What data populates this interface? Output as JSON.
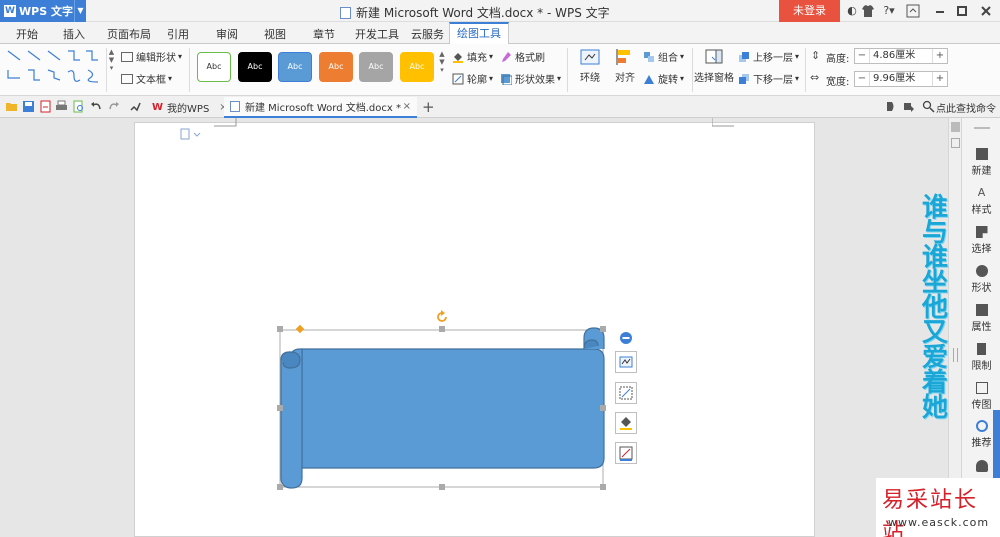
{
  "titlebar": {
    "app_name": "WPS 文字",
    "doc_title": "新建 Microsoft Word 文档.docx * - WPS 文字",
    "login_label": "未登录",
    "help_label": "?"
  },
  "menu": {
    "tabs": [
      "开始",
      "插入",
      "页面布局",
      "引用",
      "审阅",
      "视图",
      "章节",
      "开发工具",
      "云服务",
      "绘图工具"
    ],
    "active_index": 9
  },
  "ribbon": {
    "edit_shape": "编辑形状",
    "textbox": "文本框",
    "style_swatches": [
      {
        "label": "Abc",
        "bg": "#ffffff",
        "fg": "#333333",
        "border": "#6aba4c"
      },
      {
        "label": "Abc",
        "bg": "#000000",
        "fg": "#ffffff",
        "border": "#000000"
      },
      {
        "label": "Abc",
        "bg": "#5b9bd5",
        "fg": "#ffffff",
        "border": "#3d7fd6"
      },
      {
        "label": "Abc",
        "bg": "#ed7d31",
        "fg": "#ffffff",
        "border": "#ed7d31"
      },
      {
        "label": "Abc",
        "bg": "#a5a5a5",
        "fg": "#ffffff",
        "border": "#a5a5a5"
      },
      {
        "label": "Abc",
        "bg": "#ffc000",
        "fg": "#ffffff",
        "border": "#ffc000"
      }
    ],
    "fill": "填充",
    "format_brush": "格式刷",
    "outline": "轮廓",
    "shape_effect": "形状效果",
    "wrap": "环绕",
    "align": "对齐",
    "group": "组合",
    "rotate": "旋转",
    "select_pane": "选择窗格",
    "bring_forward": "上移一层",
    "send_backward": "下移一层",
    "height_label": "高度:",
    "height_value": "4.86厘米",
    "width_label": "宽度:",
    "width_value": "9.96厘米",
    "minus": "−",
    "plus": "+"
  },
  "doc_tabs": {
    "tab1": "我的WPS",
    "tab2": "新建 Microsoft Word 文档.docx *",
    "close": "×",
    "new_tab": "+",
    "find_cmd": "点此查找命令"
  },
  "side_panel": {
    "items": [
      "新建",
      "样式",
      "选择",
      "形状",
      "属性",
      "限制",
      "传图",
      "推荐"
    ]
  },
  "watermark": {
    "vertical_text": "谁与谁坐他又爱着她",
    "logo": "易采站长站",
    "url": "www.easck.com"
  },
  "colors": {
    "accent": "#3d7fd6",
    "login": "#e8523f",
    "shape_fill": "#5b9bd5",
    "shape_stroke": "#41719c"
  }
}
